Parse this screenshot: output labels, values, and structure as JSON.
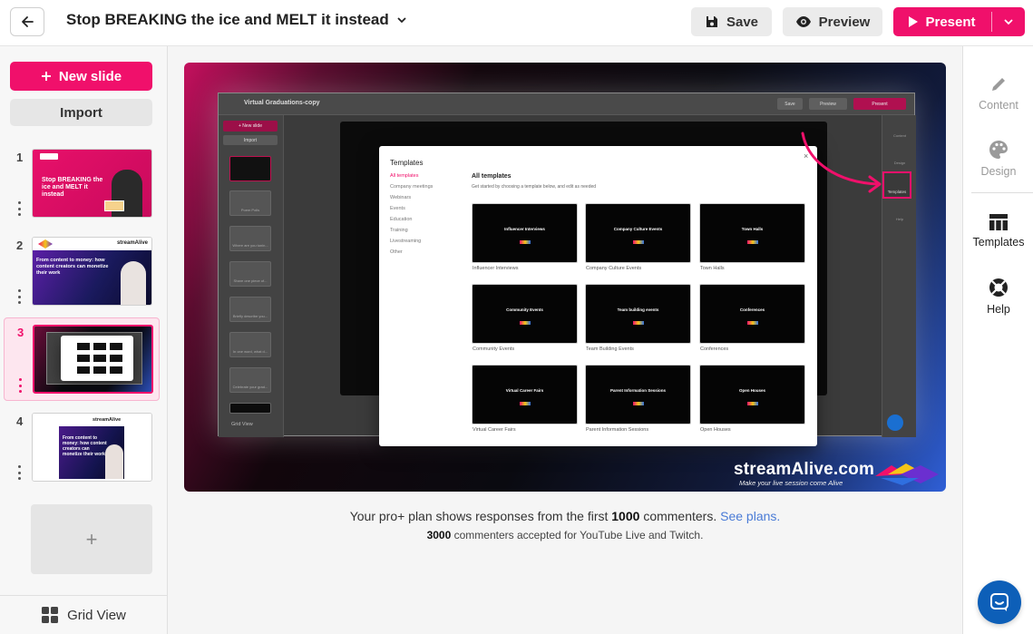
{
  "header": {
    "title": "Stop BREAKING the ice and MELT it instead",
    "save_label": "Save",
    "preview_label": "Preview",
    "present_label": "Present"
  },
  "sidebar": {
    "new_slide_label": "New slide",
    "import_label": "Import",
    "grid_view_label": "Grid View",
    "add_slide_glyph": "+",
    "slides": [
      {
        "num": "1",
        "thumb_text": "Stop BREAKING the ice and MELT it instead"
      },
      {
        "num": "2",
        "brand": "streamAlive",
        "thumb_text": "From content to money: how content creators can monetize their work"
      },
      {
        "num": "3"
      },
      {
        "num": "4",
        "brand": "streamAlive",
        "thumb_text": "From content to money: how content creators can monetize their work"
      }
    ]
  },
  "slide": {
    "inner_app_title": "Virtual Graduations-copy",
    "inner_save": "Save",
    "inner_preview": "Preview",
    "inner_present": "Present",
    "inner_new_slide": "+ New slide",
    "inner_import": "Import",
    "inner_grid_view": "Grid View",
    "inner_thumbs": [
      "Poem Polls",
      "Where are you tunin...",
      "Share one piece of...",
      "Briefly describe you...",
      "In one word, what d...",
      "Celebrate your grad..."
    ],
    "inner_right_items": [
      "Content",
      "Design",
      "Templates",
      "Help"
    ],
    "modal": {
      "title": "Templates",
      "close": "×",
      "categories": [
        "All templates",
        "Company meetings",
        "Webinars",
        "Events",
        "Education",
        "Training",
        "Livestreaming",
        "Other"
      ],
      "heading": "All templates",
      "subheading": "Get started by choosing a template below, and edit as needed",
      "templates": [
        {
          "card_title": "Influencer Interviews",
          "caption": "Influencer Interviews"
        },
        {
          "card_title": "Company Culture Events",
          "caption": "Company Culture Events"
        },
        {
          "card_title": "Town Halls",
          "caption": "Town Halls"
        },
        {
          "card_title": "Community Events",
          "caption": "Community Events"
        },
        {
          "card_title": "Team building events",
          "caption": "Team Building Events"
        },
        {
          "card_title": "Conferences",
          "caption": "Conferences"
        },
        {
          "card_title": "Virtual Career Fairs",
          "caption": "Virtual Career Fairs"
        },
        {
          "card_title": "Parent Information Sessions",
          "caption": "Parent Information Sessions"
        },
        {
          "card_title": "Open Houses",
          "caption": "Open Houses"
        }
      ]
    },
    "brand_name": "streamAlive.com",
    "brand_tagline": "Make your live session come Alive"
  },
  "plan": {
    "line1_prefix": "Your pro+ plan shows responses from the first",
    "line1_number": "1000",
    "line1_suffix": "commenters.",
    "line1_link": "See plans.",
    "line2_number": "3000",
    "line2_suffix": "commenters accepted for YouTube Live and Twitch."
  },
  "right_panel": {
    "content_label": "Content",
    "design_label": "Design",
    "templates_label": "Templates",
    "help_label": "Help"
  },
  "colors": {
    "accent": "#f0106b",
    "link": "#4a7bd6",
    "chat": "#0d5fb8"
  },
  "icons": [
    "arrow-left-icon",
    "chevron-down-icon",
    "save-icon",
    "eye-icon",
    "play-icon",
    "plus-icon",
    "grid-icon",
    "pencil-icon",
    "palette-icon",
    "templates-icon",
    "help-icon",
    "chat-icon"
  ]
}
